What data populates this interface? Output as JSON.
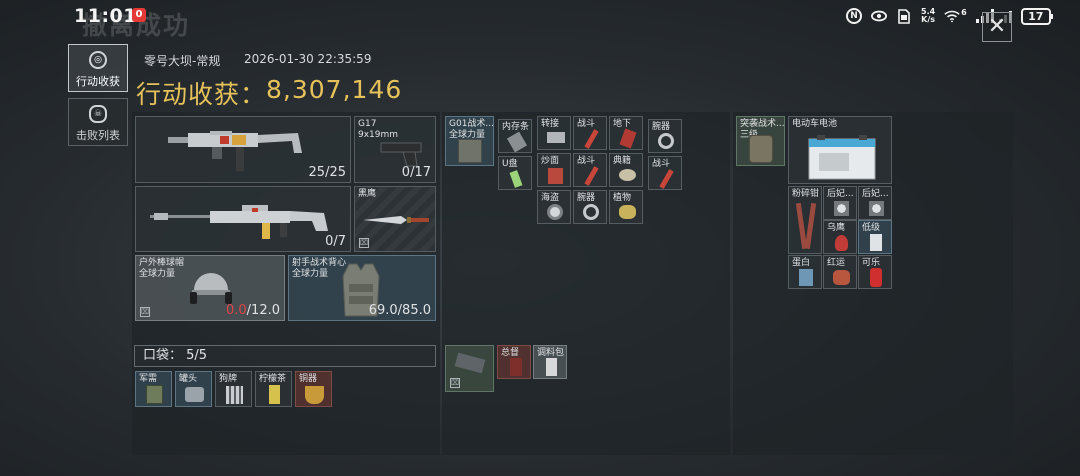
{
  "status_bar": {
    "time": "11:01",
    "notification_badge": "0",
    "net_speed_value": "5.4",
    "net_speed_unit": "K/s",
    "signal_label": "6",
    "battery": "17",
    "icons": [
      "nfc-icon",
      "eye-icon",
      "sim-icon",
      "wifi-icon",
      "signal-icon",
      "battery-icon"
    ]
  },
  "background_title": "撤离成功",
  "nav": {
    "items": [
      {
        "label": "行动收获",
        "icon": "target-icon",
        "active": true
      },
      {
        "label": "击败列表",
        "icon": "skull-icon",
        "active": false
      }
    ]
  },
  "header": {
    "map_name": "零号大坝-常规",
    "datetime": "2026-01-30 22:35:59",
    "haul_label": "行动收获：",
    "haul_value": "8,307,146"
  },
  "equipment": {
    "primary_weapon": {
      "count": "25/25"
    },
    "secondary_weapon": {
      "count": "0/7"
    },
    "pistol": {
      "name": "G17",
      "ammo": "9x19mm",
      "count": "0/17"
    },
    "melee": {
      "name": "黑鹰"
    },
    "helmet": {
      "name": "户外棒球帽",
      "sub": "全球力量",
      "durability_current": "0.0",
      "durability_max": "/12.0"
    },
    "armor": {
      "name": "射手战术背心",
      "sub": "全球力量",
      "durability": "69.0/85.0"
    }
  },
  "pocket": {
    "label": "口袋：",
    "capacity": "5/5",
    "items": [
      "军需",
      "罐头",
      "狗牌",
      "柠檬茶",
      "铜器"
    ]
  },
  "rig": {
    "title": "G01战术...",
    "sub": "全球力量",
    "items": [
      {
        "label": "内存条"
      },
      {
        "label": "转接"
      },
      {
        "label": "战斗"
      },
      {
        "label": "地下"
      },
      {
        "label": "腕器"
      },
      {
        "label": "U盘"
      },
      {
        "label": "炒面"
      },
      {
        "label": "战斗"
      },
      {
        "label": "典籍"
      },
      {
        "label": "战斗"
      },
      {
        "label": "海盗"
      },
      {
        "label": "腕器"
      },
      {
        "label": "植物"
      }
    ],
    "lower_items": [
      {
        "label": "总督"
      },
      {
        "label": "调料包"
      }
    ]
  },
  "backpack": {
    "title": "突袭战术...",
    "sub": "三级",
    "items": [
      {
        "label": "电动车电池"
      },
      {
        "label": "粉碎钳"
      },
      {
        "label": "后妃..."
      },
      {
        "label": "后妃..."
      },
      {
        "label": "乌鹰"
      },
      {
        "label": "低级"
      },
      {
        "label": "蛋白"
      },
      {
        "label": "红运"
      },
      {
        "label": "可乐"
      }
    ]
  }
}
